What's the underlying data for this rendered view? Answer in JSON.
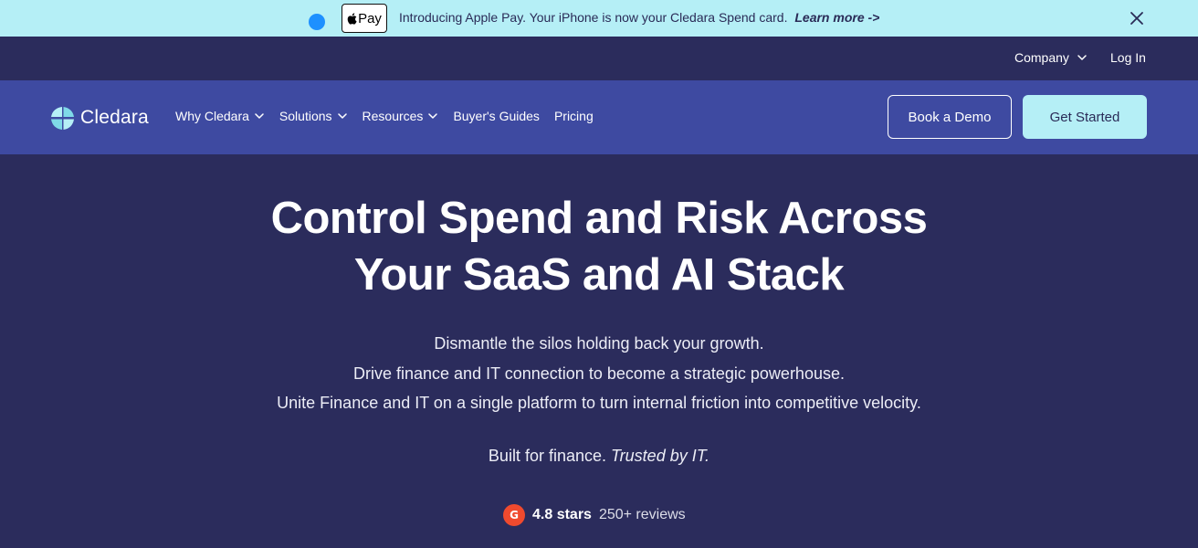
{
  "announcement": {
    "apple_pay_label": "Pay",
    "message": "Introducing Apple Pay. Your iPhone is now your Cledara Spend card.",
    "link": "Learn more ->",
    "close_icon": "close-icon"
  },
  "utility_nav": {
    "company": "Company",
    "login": "Log In"
  },
  "brand": {
    "name": "Cledara",
    "logo_icon": "cledara-logo-icon"
  },
  "nav": {
    "items": [
      {
        "label": "Why Cledara",
        "dropdown": true
      },
      {
        "label": "Solutions",
        "dropdown": true
      },
      {
        "label": "Resources",
        "dropdown": true
      },
      {
        "label": "Buyer's Guides",
        "dropdown": false
      },
      {
        "label": "Pricing",
        "dropdown": false
      }
    ],
    "book_demo": "Book a Demo",
    "get_started": "Get Started"
  },
  "hero": {
    "title_line1": "Control Spend and Risk Across",
    "title_line2": "Your SaaS and AI Stack",
    "subtitle_lines": [
      "Dismantle the silos holding back your growth.",
      "Drive finance and IT connection to become a strategic powerhouse.",
      "Unite Finance and IT on a single platform to turn internal friction into competitive velocity."
    ],
    "tagline_plain": "Built for finance.",
    "tagline_italic": "Trusted by IT.",
    "reviews": {
      "badge": "G",
      "stars": "4.8 stars",
      "count": "250+ reviews"
    }
  },
  "colors": {
    "announcement_bg": "#b5eff6",
    "page_bg": "#2b2c5c",
    "nav_bg": "#3e4aa1",
    "accent_button": "#b5eff6",
    "g2_red": "#f04a2e"
  }
}
